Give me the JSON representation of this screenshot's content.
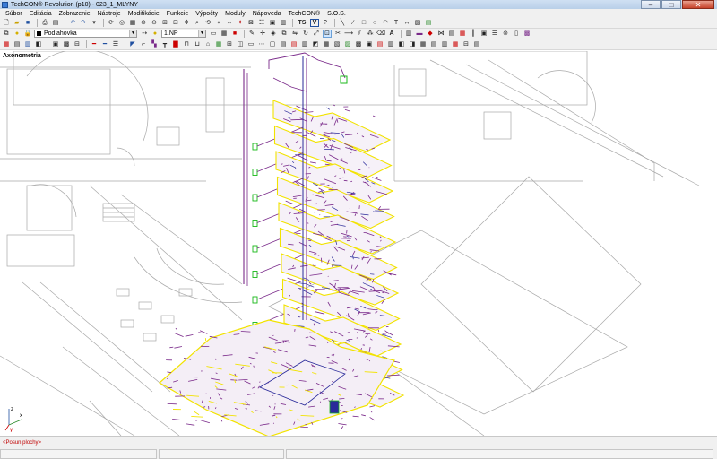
{
  "window": {
    "title": "TechCON® Revolution  (p10) - 023_1_MLYNY",
    "buttons": {
      "minimize": "–",
      "maximize": "□",
      "close": "✕"
    }
  },
  "menu": {
    "items": [
      "Súbor",
      "Editácia",
      "Zobrazenie",
      "Nástroje",
      "Modifikácie",
      "Funkcie",
      "Výpočty",
      "Moduly",
      "Nápoveda",
      "TechCON®",
      "S.O.S."
    ]
  },
  "toolbar1": {
    "text_buttons": {
      "ts": "TS",
      "v": "V"
    }
  },
  "toolbar2": {
    "layer_combo": "Podlahovka",
    "floor_combo": "1.NP",
    "text_a": "A"
  },
  "view": {
    "label": "Axonometria",
    "axis_labels": {
      "z": "z",
      "x": "x",
      "y": "y"
    }
  },
  "status": {
    "message": "<Posun plochy>"
  },
  "colors": {
    "pipe_purple": "#7a2a8a",
    "pipe_blue": "#2a2a9a",
    "pipe_yellow": "#f2e300",
    "line_gray": "#a8a8a8",
    "marker_green": "#18b818",
    "status_red": "#c00000"
  }
}
